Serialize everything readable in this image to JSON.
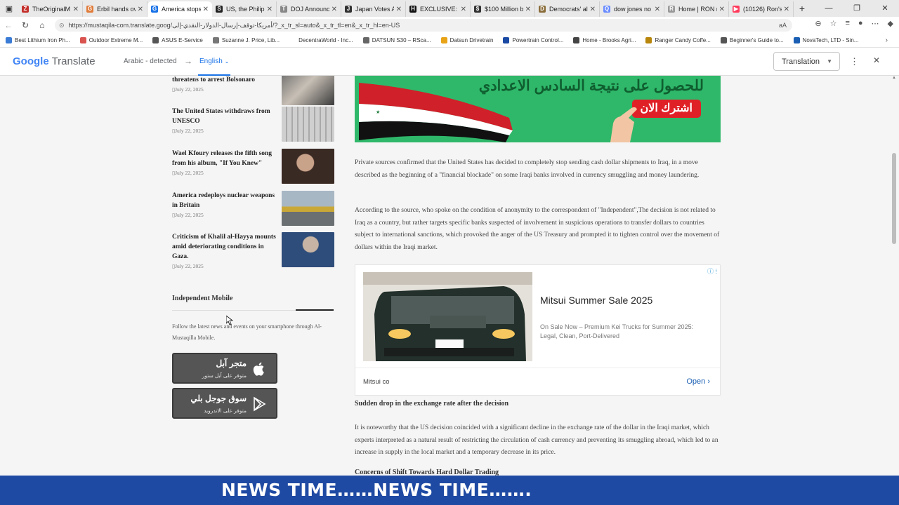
{
  "tabs": [
    {
      "title": "TheOriginalM",
      "color": "#c4302b",
      "glyph": "Z"
    },
    {
      "title": "Erbil hands ov",
      "color": "#e07b39",
      "glyph": "G"
    },
    {
      "title": "America stops",
      "color": "#1a73e8",
      "glyph": "G",
      "active": true
    },
    {
      "title": "US, the Philipp",
      "color": "#222222",
      "glyph": "S"
    },
    {
      "title": "DOJ Announce",
      "color": "#888888",
      "glyph": "T"
    },
    {
      "title": "Japan Votes A",
      "color": "#333333",
      "glyph": "J"
    },
    {
      "title": "EXCLUSIVE: M",
      "color": "#111111",
      "glyph": "H"
    },
    {
      "title": "$100 Million b",
      "color": "#333333",
      "glyph": "$"
    },
    {
      "title": "Democrats' all",
      "color": "#8a6d3b",
      "glyph": "D"
    },
    {
      "title": "dow jones no",
      "color": "#6b8cff",
      "glyph": "Q"
    },
    {
      "title": "Home | RON n",
      "color": "#999999",
      "glyph": "R"
    },
    {
      "title": "(10126) Ron's",
      "color": "#ff3b5c",
      "glyph": "▶"
    }
  ],
  "address": {
    "url": "https://mustaqila-com.translate.goog/أمريكا-توقف-إرسال-الدولار-النقدي-إلى/?_x_tr_sl=auto&_x_tr_tl=en&_x_tr_hl=en-US"
  },
  "bookmarks": [
    {
      "label": "Best Lithium Iron Ph...",
      "color": "#3a7bd5"
    },
    {
      "label": "Outdoor Extreme M...",
      "color": "#d9534f"
    },
    {
      "label": "ASUS E-Service",
      "color": "#555555"
    },
    {
      "label": "Suzanne J. Price, Lib...",
      "color": "#777777"
    },
    {
      "label": "DecentraWorld - Inc...",
      "color": "#ffffff"
    },
    {
      "label": "DATSUN S30 – RSca...",
      "color": "#666666"
    },
    {
      "label": "Datsun Drivetrain",
      "color": "#e8a317"
    },
    {
      "label": "Powertrain Control...",
      "color": "#1a4aa3"
    },
    {
      "label": "Home - Brooks Agri...",
      "color": "#444444"
    },
    {
      "label": "Ranger Candy Coffe...",
      "color": "#b8860b"
    },
    {
      "label": "Beginner's Guide to...",
      "color": "#555555"
    },
    {
      "label": "NovaTech, LTD - Sin...",
      "color": "#1a5fb4"
    }
  ],
  "translate": {
    "logo_google": "Google",
    "logo_translate": "Translate",
    "source": "Arabic - detected",
    "target": "English",
    "mode": "Translation"
  },
  "sidebar": {
    "items": [
      {
        "title": "threatens to arrest Bolsonaro",
        "date": "July 22, 2025"
      },
      {
        "title": "The United States withdraws from UNESCO",
        "date": "July 22, 2025"
      },
      {
        "title": "Wael Kfoury releases the fifth song from his album, \"If You Knew\"",
        "date": "July 22, 2025"
      },
      {
        "title": "America redeploys nuclear weapons in Britain",
        "date": "July 22, 2025"
      },
      {
        "title": "Criticism of Khalil al-Hayya mounts amid deteriorating conditions in Gaza.",
        "date": "July 22, 2025"
      }
    ],
    "mobile_heading": "Independent Mobile",
    "mobile_text": "Follow the latest news and events on your smartphone through Al-Mustaqilla Mobile.",
    "apple": {
      "title": "متجر آبل",
      "sub": "متوفر على آبل ستور"
    },
    "google": {
      "title": "سوق جوجل بلي",
      "sub": "متوفر على الاندرويد"
    }
  },
  "main": {
    "banner_line1": "للحصول على نتيجة السادس الاعدادي",
    "banner_line2": "اشترك الان",
    "p1": "Private sources confirmed that the United States has decided to completely stop sending cash dollar shipments to Iraq, in a move described as the beginning of a \"financial blockade\" on some Iraqi banks involved in currency smuggling and money laundering.",
    "p2": "According to the source, who spoke on the condition of anonymity to the correspondent of \"Independent\",The decision is not related to Iraq as a country, but rather targets specific banks suspected of involvement in suspicious operations to transfer dollars to countries subject to international sanctions, which provoked the anger of the US Treasury and prompted it to tighten control over the movement of dollars within the Iraqi market.",
    "ad": {
      "title": "Mitsui Summer Sale 2025",
      "desc": "On Sale Now – Premium Kei Trucks for Summer 2025: Legal, Clean, Port-Delivered",
      "brand": "Mitsui co",
      "cta": "Open"
    },
    "subheading": "Sudden drop in the exchange rate after the decision",
    "p3": "It is noteworthy that the US decision coincided with a significant decline in the exchange rate of the dollar in the Iraqi market, which experts interpreted as a natural result of restricting the circulation of cash currency and preventing its smuggling abroad, which led to an increase in supply in the local market and a temporary decrease in its price.",
    "subheading2": "Concerns of Shift Towards Hard Dollar Trading"
  },
  "ticker": "NEWS TIME……NEWS TIME……."
}
